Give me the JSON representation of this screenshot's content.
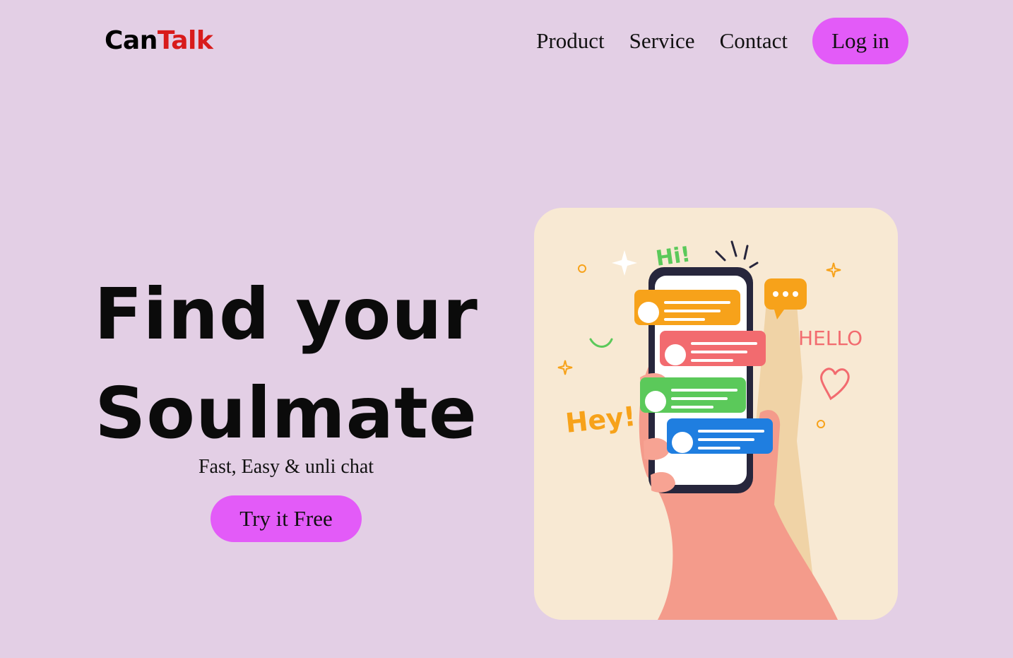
{
  "logo": {
    "part1": "Can",
    "part2": "Talk"
  },
  "nav": {
    "links": [
      "Product",
      "Service",
      "Contact"
    ],
    "login_label": "Log in"
  },
  "hero": {
    "title_line1": "Find your",
    "title_line2": "Soulmate",
    "tagline": "Fast, Easy & unli chat",
    "cta_label": "Try it Free"
  },
  "illustration": {
    "hi_text": "Hi!",
    "hey_text": "Hey!",
    "hello_text": "HELLO"
  },
  "colors": {
    "background": "#e3cfe5",
    "accent": "#e35bf8",
    "logo_red": "#d81b1b",
    "card_bg": "#f8e9d3"
  }
}
